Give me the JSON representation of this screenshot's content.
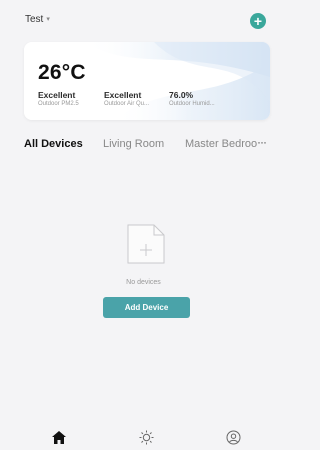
{
  "header": {
    "home_name": "Test",
    "caret_glyph": "▾",
    "add_icon": "plus-circle-icon",
    "add_glyph": "+"
  },
  "weather": {
    "temperature": "26°C",
    "stats": [
      {
        "value": "Excellent",
        "label": "Outdoor PM2.5"
      },
      {
        "value": "Excellent",
        "label": "Outdoor Air Qu..."
      },
      {
        "value": "76.0%",
        "label": "Outdoor Humid..."
      }
    ]
  },
  "tabs": [
    {
      "label": "All Devices",
      "active": true
    },
    {
      "label": "Living Room",
      "active": false
    },
    {
      "label": "Master Bedroom",
      "active": false
    }
  ],
  "tabs_more": "···",
  "empty_state": {
    "icon": "empty-document-icon",
    "message": "No devices"
  },
  "add_device_label": "Add Device",
  "tabbar": [
    {
      "icon": "home-icon",
      "active": true
    },
    {
      "icon": "scene-sun-icon",
      "active": false
    },
    {
      "icon": "profile-icon",
      "active": false
    }
  ],
  "colors": {
    "accent": "#3aa79b",
    "button": "#4aa3a9",
    "background": "#f4f4f6"
  }
}
